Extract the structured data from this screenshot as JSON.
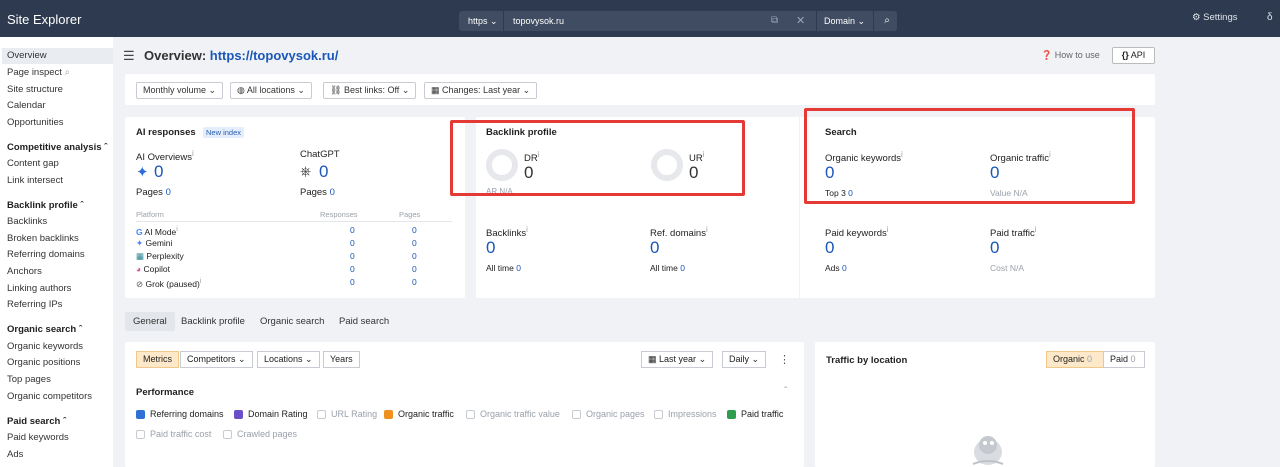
{
  "topbar": {
    "brand": "Site Explorer",
    "protocol": "https",
    "url": "topovysok.ru",
    "mode": "Domain",
    "settings": "Settings"
  },
  "sidebar": {
    "items": [
      {
        "label": "Overview",
        "active": true
      },
      {
        "label": "Page inspect"
      },
      {
        "label": "Site structure"
      },
      {
        "label": "Calendar"
      },
      {
        "label": "Opportunities"
      },
      {
        "label": "Competitive analysis",
        "header": true
      },
      {
        "label": "Content gap"
      },
      {
        "label": "Link intersect"
      },
      {
        "label": "Backlink profile",
        "header": true
      },
      {
        "label": "Backlinks"
      },
      {
        "label": "Broken backlinks"
      },
      {
        "label": "Referring domains"
      },
      {
        "label": "Anchors"
      },
      {
        "label": "Linking authors"
      },
      {
        "label": "Referring IPs"
      },
      {
        "label": "Organic search",
        "header": true
      },
      {
        "label": "Organic keywords"
      },
      {
        "label": "Organic positions"
      },
      {
        "label": "Top pages"
      },
      {
        "label": "Organic competitors"
      },
      {
        "label": "Paid search",
        "header": true
      },
      {
        "label": "Paid keywords"
      },
      {
        "label": "Ads"
      }
    ]
  },
  "header": {
    "title_prefix": "Overview:",
    "title_url": "https://topovysok.ru/",
    "how_to_use": "How to use",
    "api": "API"
  },
  "filters": [
    "Monthly volume",
    "All locations",
    "Best links: Off",
    "Changes: Last year"
  ],
  "ai": {
    "title": "AI responses",
    "badge": "New index",
    "overviews_label": "AI Overviews",
    "overviews_value": "0",
    "overviews_pages_label": "Pages",
    "overviews_pages": "0",
    "chatgpt_label": "ChatGPT",
    "chatgpt_value": "0",
    "chatgpt_pages_label": "Pages",
    "chatgpt_pages": "0",
    "table_headers": [
      "Platform",
      "Responses",
      "Pages"
    ],
    "rows": [
      {
        "platform": "AI Mode",
        "responses": "0",
        "pages": "0"
      },
      {
        "platform": "Gemini",
        "responses": "0",
        "pages": "0"
      },
      {
        "platform": "Perplexity",
        "responses": "0",
        "pages": "0"
      },
      {
        "platform": "Copilot",
        "responses": "0",
        "pages": "0"
      },
      {
        "platform": "Grok (paused)",
        "responses": "0",
        "pages": "0"
      }
    ]
  },
  "backlink": {
    "title": "Backlink profile",
    "dr_label": "DR",
    "dr_value": "0",
    "ar_label": "AR N/A",
    "ur_label": "UR",
    "ur_value": "0",
    "backlinks_label": "Backlinks",
    "backlinks_value": "0",
    "backlinks_sub": "All time",
    "backlinks_sub_val": "0",
    "refdomains_label": "Ref. domains",
    "refdomains_value": "0",
    "refdomains_sub": "All time",
    "refdomains_sub_val": "0"
  },
  "search": {
    "title": "Search",
    "ok_label": "Organic keywords",
    "ok_value": "0",
    "ok_sub": "Top 3",
    "ok_sub_val": "0",
    "ot_label": "Organic traffic",
    "ot_value": "0",
    "ot_sub": "Value",
    "ot_sub_val": "N/A",
    "pk_label": "Paid keywords",
    "pk_value": "0",
    "pk_sub": "Ads",
    "pk_sub_val": "0",
    "pt_label": "Paid traffic",
    "pt_value": "0",
    "pt_sub": "Cost",
    "pt_sub_val": "N/A"
  },
  "tabs": [
    "General",
    "Backlink profile",
    "Organic search",
    "Paid search"
  ],
  "controls": {
    "segments": [
      "Metrics",
      "Competitors",
      "Locations",
      "Years"
    ],
    "period": "Last year",
    "interval": "Daily",
    "performance": "Performance",
    "metrics": [
      {
        "label": "Referring domains",
        "checked": true,
        "color": "#2f6fd6"
      },
      {
        "label": "Domain Rating",
        "checked": true,
        "color": "#6a4fc8"
      },
      {
        "label": "URL Rating",
        "checked": false
      },
      {
        "label": "Organic traffic",
        "checked": true,
        "color": "#f0901f"
      },
      {
        "label": "Organic traffic value",
        "checked": false
      },
      {
        "label": "Organic pages",
        "checked": false
      },
      {
        "label": "Impressions",
        "checked": false
      },
      {
        "label": "Paid traffic",
        "checked": true,
        "color": "#2e9d4e"
      },
      {
        "label": "Paid traffic cost",
        "checked": false
      },
      {
        "label": "Crawled pages",
        "checked": false
      }
    ]
  },
  "traffic_location": {
    "title": "Traffic by location",
    "organic_label": "Organic",
    "organic_value": "0",
    "paid_label": "Paid",
    "paid_value": "0"
  },
  "colors": {
    "topbar": "#2d3a4f",
    "accent_blue": "#1a57b8",
    "highlight_red": "#e53935",
    "active_orange": "#fde9c9"
  }
}
